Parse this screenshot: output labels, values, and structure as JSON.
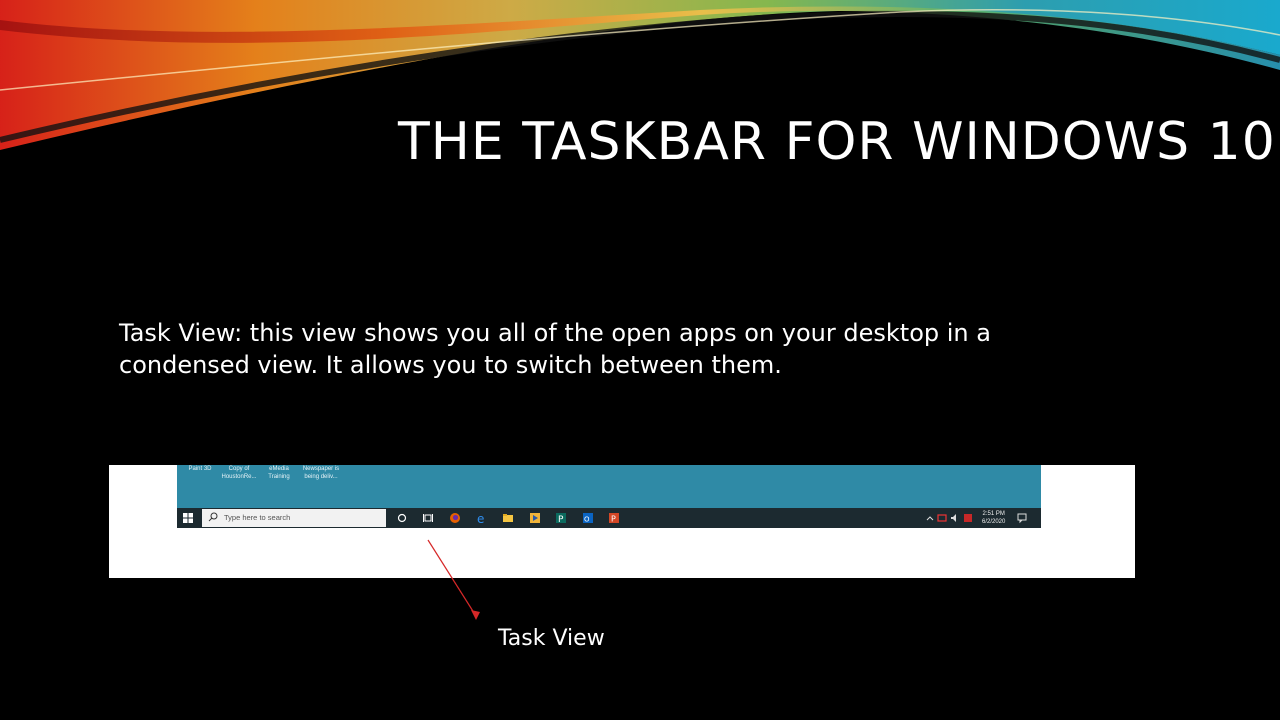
{
  "slide": {
    "title": "THE TASKBAR FOR WINDOWS 10",
    "body": "Task View: this view shows you all of the open apps on your desktop in a condensed view.  It allows you to switch between them.",
    "callout": "Task View"
  },
  "screenshot": {
    "desktop_icons": [
      {
        "line1": "Paint 3D",
        "line2": ""
      },
      {
        "line1": "Copy of",
        "line2": "HoustonRe..."
      },
      {
        "line1": "eMedia",
        "line2": "Training"
      },
      {
        "line1": "Newspaper is",
        "line2": "being deliv..."
      }
    ],
    "taskbar": {
      "search_placeholder": "Type here to search",
      "pinned_apps": [
        "cortana-circle",
        "task-view",
        "firefox",
        "edge",
        "file-explorer",
        "media-player",
        "publisher",
        "outlook",
        "powerpoint"
      ],
      "tray": {
        "time": "2:51 PM",
        "date": "6/2/2020"
      }
    }
  },
  "colors": {
    "desktop": "#2f8aa6",
    "taskbar": "#1c2a30",
    "arrow": "#d62828"
  }
}
